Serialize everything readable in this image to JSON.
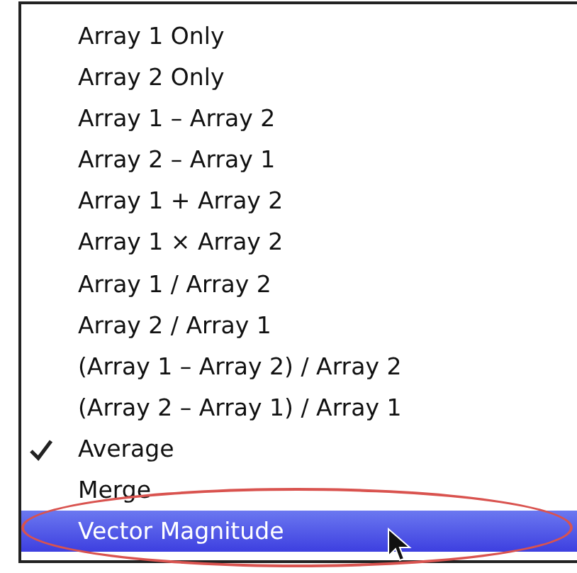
{
  "menu": {
    "items": [
      {
        "label": "Array 1 Only",
        "checked": false,
        "selected": false
      },
      {
        "label": "Array 2 Only",
        "checked": false,
        "selected": false
      },
      {
        "label": "Array 1 – Array 2",
        "checked": false,
        "selected": false
      },
      {
        "label": "Array 2 – Array 1",
        "checked": false,
        "selected": false
      },
      {
        "label": "Array 1 + Array 2",
        "checked": false,
        "selected": false
      },
      {
        "label": "Array 1 × Array 2",
        "checked": false,
        "selected": false
      },
      {
        "label": "Array 1 / Array 2",
        "checked": false,
        "selected": false
      },
      {
        "label": "Array 2 / Array 1",
        "checked": false,
        "selected": false
      },
      {
        "label": "(Array 1 – Array 2) / Array 2",
        "checked": false,
        "selected": false
      },
      {
        "label": "(Array 2 – Array 1) / Array 1",
        "checked": false,
        "selected": false
      },
      {
        "label": "Average",
        "checked": true,
        "selected": false
      },
      {
        "label": "Merge",
        "checked": false,
        "selected": false
      },
      {
        "label": "Vector Magnitude",
        "checked": false,
        "selected": true
      }
    ]
  }
}
